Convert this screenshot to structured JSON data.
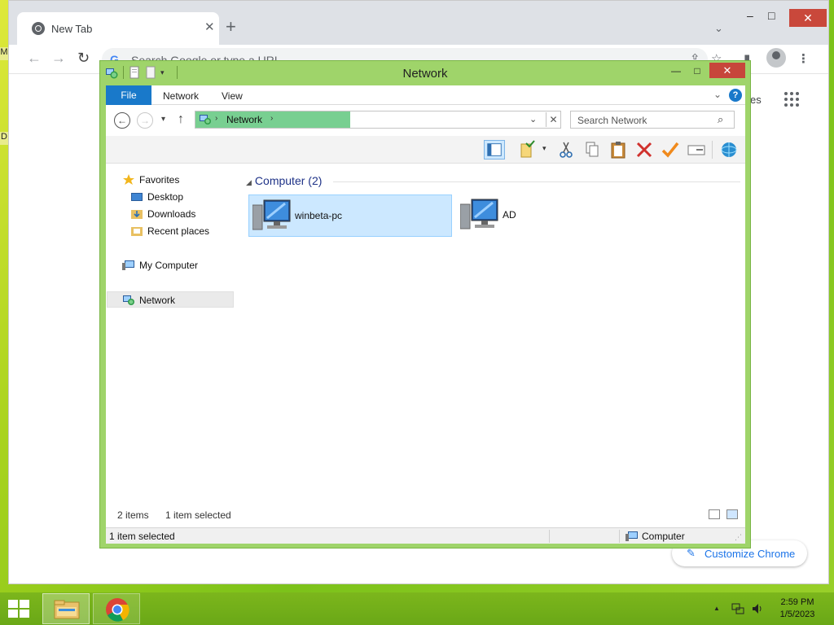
{
  "desktop": {
    "edge_frag_1": "M",
    "edge_frag_2": "D"
  },
  "chrome": {
    "tab_title": "New Tab",
    "tab_close": "✕",
    "new_tab": "+",
    "tab_search": "⌄",
    "minimize": "–",
    "maximize": "□",
    "close": "✕",
    "back": "←",
    "forward": "→",
    "reload": "↻",
    "omnibox_g": "G",
    "omnibox_placeholder": "Search Google or type a URL",
    "images_fragment": "es",
    "customize_label": "Customize Chrome"
  },
  "explorer": {
    "title": "Network",
    "caption_minimize": "—",
    "caption_maximize": "□",
    "caption_close": "✕",
    "ribbon": {
      "file": "File",
      "tabs": [
        "Network",
        "View"
      ],
      "help": "?"
    },
    "address": {
      "crumb": "Network",
      "sep": "›",
      "dropdown": "⌄",
      "clear": "✕"
    },
    "nav": {
      "back": "←",
      "forward": "→",
      "recent": "▾",
      "up": "↑"
    },
    "search_placeholder": "Search Network",
    "navpane": {
      "favorites": "Favorites",
      "desktop": "Desktop",
      "downloads": "Downloads",
      "recent_places": "Recent places",
      "my_computer": "My Computer",
      "network": "Network"
    },
    "group_header": "Computer (2)",
    "group_tri": "◢",
    "items": [
      {
        "name": "winbeta-pc",
        "selected": true
      },
      {
        "name": "AD",
        "selected": false
      }
    ],
    "status_upper": {
      "count": "2 items",
      "selected": "1 item selected"
    },
    "status_lower": {
      "left": "1 item selected",
      "right": "Computer"
    }
  },
  "taskbar": {
    "tray_arrow": "▲",
    "clock_time": "2:59 PM",
    "clock_date": "1/5/2023"
  },
  "colors": {
    "explorer_frame": "#9fd46a",
    "ribbon_file": "#1979ca",
    "address_highlight": "#78cf91",
    "close_red": "#c7463b",
    "taskbar": "#7cb61c"
  }
}
